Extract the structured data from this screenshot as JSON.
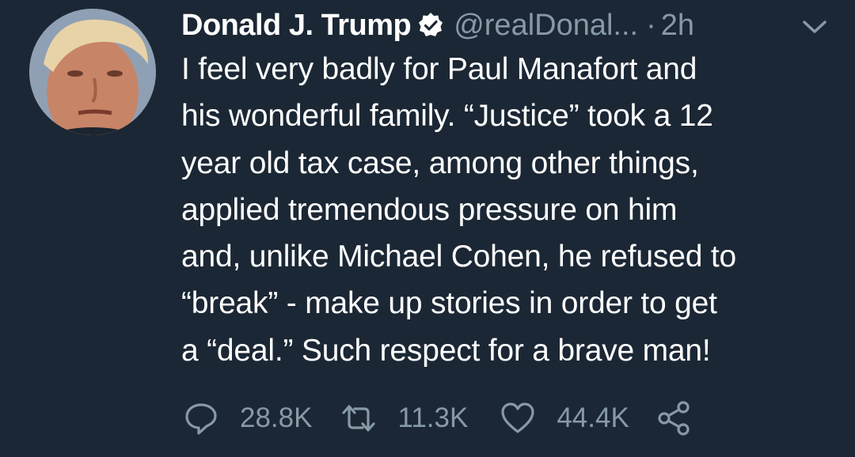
{
  "user": {
    "display_name": "Donald J. Trump",
    "handle": "@realDonal...",
    "separator": "·",
    "time_ago": "2h",
    "verified": true
  },
  "tweet": {
    "lines": [
      "I feel very badly for Paul Manafort and",
      "his wonderful family. “Justice” took a 12",
      "year old tax case, among other things,",
      "applied tremendous pressure on him",
      "and, unlike Michael Cohen, he refused to",
      "“break” - make up stories in order to get",
      "a “deal.” Such respect for a brave man!"
    ]
  },
  "actions": {
    "replies": "28.8K",
    "retweets": "11.3K",
    "likes": "44.4K"
  },
  "icons": {
    "verified": "verified-badge-icon",
    "menu": "chevron-down-icon",
    "reply": "reply-icon",
    "retweet": "retweet-icon",
    "like": "heart-icon",
    "share": "share-icon"
  },
  "colors": {
    "background": "#1b2734",
    "text": "#ffffff",
    "muted": "#8899a6"
  }
}
